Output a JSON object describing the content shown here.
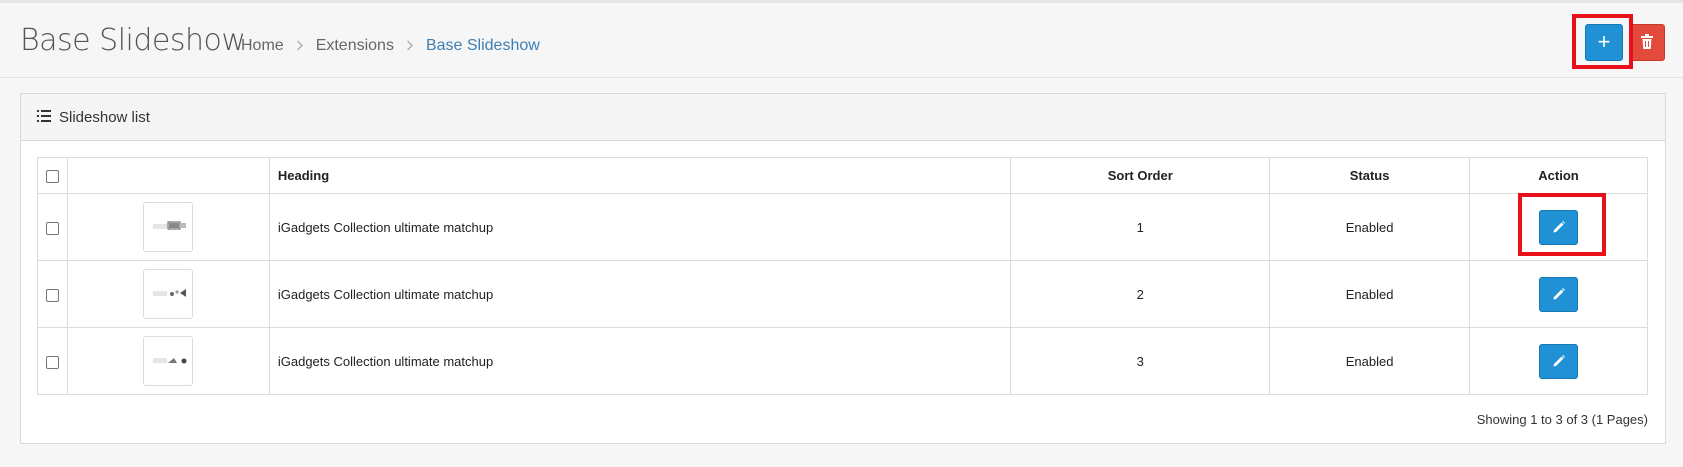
{
  "header": {
    "title": "Base Slideshow",
    "breadcrumb": [
      {
        "label": "Home",
        "active": false
      },
      {
        "label": "Extensions",
        "active": false
      },
      {
        "label": "Base Slideshow",
        "active": true
      }
    ],
    "separator": ">",
    "add_button_icon": "+",
    "add_icon": "plus-icon",
    "delete_icon": "trash-icon"
  },
  "panel": {
    "title": "Slideshow list",
    "title_icon": "list-icon"
  },
  "table": {
    "columns": {
      "heading": "Heading",
      "sort_order": "Sort Order",
      "status": "Status",
      "action": "Action"
    },
    "rows": [
      {
        "heading": "iGadgets Collection ultimate matchup",
        "sort_order": "1",
        "status": "Enabled"
      },
      {
        "heading": "iGadgets Collection ultimate matchup",
        "sort_order": "2",
        "status": "Enabled"
      },
      {
        "heading": "iGadgets Collection ultimate matchup",
        "sort_order": "3",
        "status": "Enabled"
      }
    ],
    "edit_icon": "pencil-icon"
  },
  "pagination": {
    "text": "Showing 1 to 3 of 3 (1 Pages)"
  },
  "colors": {
    "primary": "#1f91d4",
    "danger": "#e24b3b",
    "highlight": "#e8101b",
    "link": "#3d7fb5"
  }
}
